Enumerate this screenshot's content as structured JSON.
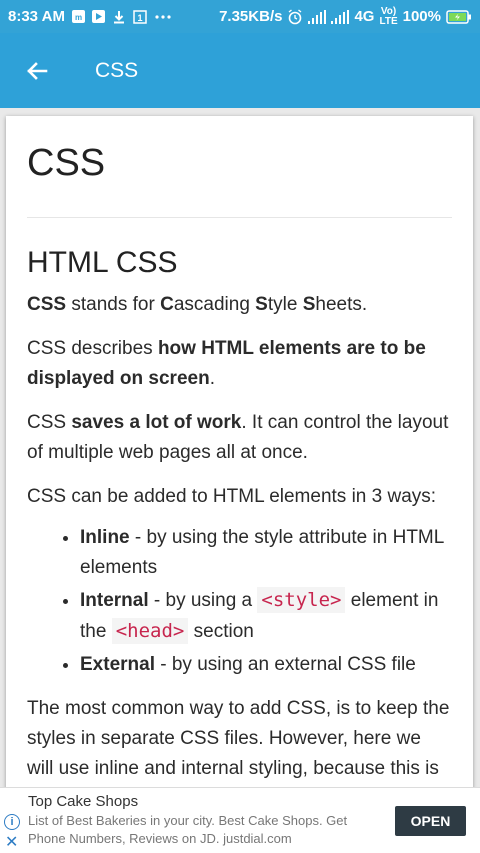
{
  "status_bar": {
    "time": "8:33 AM",
    "speed": "7.35KB/s",
    "network": "4G",
    "volte_top": "Vo)",
    "volte_bottom": "LTE",
    "battery": "100%",
    "sim_badge": "1"
  },
  "app_bar": {
    "title": "CSS"
  },
  "content": {
    "page_title": "CSS",
    "section_title": "HTML CSS",
    "p1": {
      "b1": "C",
      "t1": "SS stands for ",
      "b2": "C",
      "t2": "ascading ",
      "b3": "S",
      "t3": "tyle ",
      "b4": "S",
      "t4": "heets."
    },
    "p1_lead": "CSS",
    "p2": {
      "t1": "CSS describes ",
      "b1": "how HTML elements are to be displayed on screen",
      "t2": "."
    },
    "p3": {
      "t1": "CSS ",
      "b1": "saves a lot of work",
      "t2": ". It can control the layout of multiple web pages all at once."
    },
    "p4": "CSS can be added to HTML elements in 3 ways:",
    "ways": [
      {
        "name": "Inline",
        "text": " - by using the style attribute in HTML elements"
      },
      {
        "name": "Internal",
        "t1": " - by using a ",
        "code1": "<style>",
        "t2": " element in the ",
        "code2": "<head>",
        "t3": " section"
      },
      {
        "name": "External",
        "text": " - by using an external CSS file"
      }
    ],
    "p5": "The most common way to add CSS, is to keep the styles in separate CSS files. However, here we will use inline and internal styling, because this is easier to demonstrate, and easier for you"
  },
  "ad": {
    "title": "Top Cake Shops",
    "text": "List of Best Bakeries in your city. Best Cake Shops. Get Phone Numbers, Reviews on JD. justdial.com",
    "button": "OPEN",
    "info_glyph": "i",
    "close_glyph": "✕"
  }
}
